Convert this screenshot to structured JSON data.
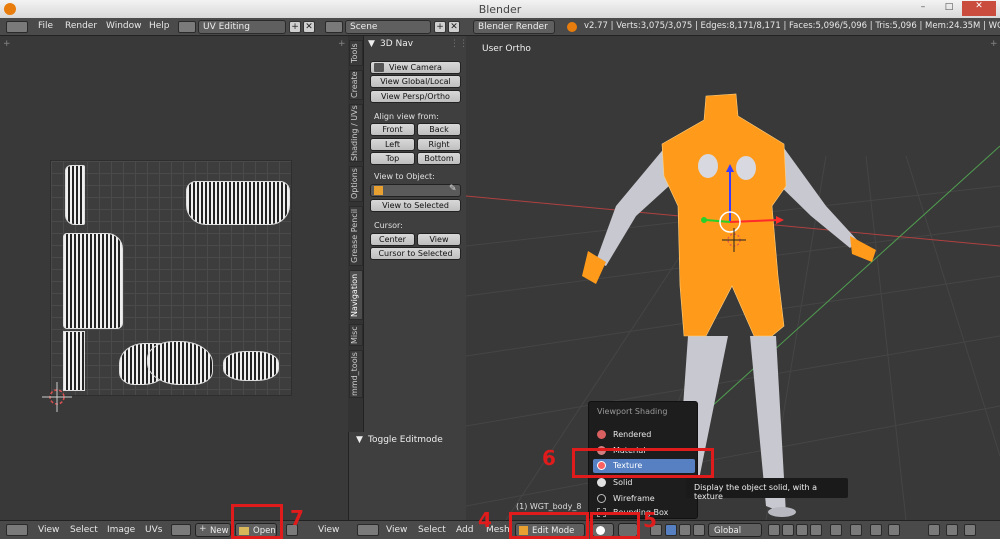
{
  "window": {
    "title": "Blender"
  },
  "menu": [
    "File",
    "Render",
    "Window",
    "Help"
  ],
  "screen_layout": "UV Editing",
  "scene": "Scene",
  "render_engine": "Blender Render",
  "stats": "v2.77 | Verts:3,075/3,075 | Edges:8,171/8,171 | Faces:5,096/5,096 | Tris:5,096 | Mem:24.35M | WGT_body_8",
  "tool_tabs": [
    "Tools",
    "Create",
    "Shading / UVs",
    "Options",
    "Grease Pencil",
    "Navigation",
    "Misc",
    "mmd_tools"
  ],
  "nav_panel": {
    "header": "3D Nav",
    "view_camera": "View Camera",
    "view_global_local": "View Global/Local",
    "view_persp_ortho": "View Persp/Ortho",
    "align_label": "Align view from:",
    "front": "Front",
    "back": "Back",
    "left": "Left",
    "right": "Right",
    "top": "Top",
    "bottom": "Bottom",
    "view_to_object": "View to Object:",
    "view_to_selected": "View to Selected",
    "cursor_label": "Cursor:",
    "center": "Center",
    "view": "View",
    "cursor_to_selected": "Cursor to Selected",
    "toggle_editmode": "Toggle Editmode"
  },
  "viewport": {
    "label": "User Ortho",
    "object_info": "(1) WGT_body_8"
  },
  "uv_bottom": {
    "view": "View",
    "select": "Select",
    "image": "Image",
    "uvs": "UVs",
    "new": "New",
    "open": "Open",
    "view2": "View"
  },
  "view3d_bottom": {
    "view": "View",
    "select": "Select",
    "add": "Add",
    "mesh": "Mesh",
    "mode": "Edit Mode",
    "orientation": "Global"
  },
  "shading_menu": {
    "title": "Viewport Shading",
    "items": [
      {
        "label": "Rendered",
        "color": "#d86060"
      },
      {
        "label": "Material",
        "color": "#d08080"
      },
      {
        "label": "Texture",
        "color": "#ff6060"
      },
      {
        "label": "Solid",
        "color": "#e0e0e0"
      },
      {
        "label": "Wireframe",
        "color": "#bbbbbb"
      },
      {
        "label": "Bounding Box",
        "color": "#999999"
      }
    ],
    "highlight": "Texture"
  },
  "tooltip": "Display the object solid, with a texture",
  "annotations": {
    "a4": "4",
    "a6": "6",
    "a7": "7",
    "a5": "5",
    "color": "#e01b1b"
  }
}
